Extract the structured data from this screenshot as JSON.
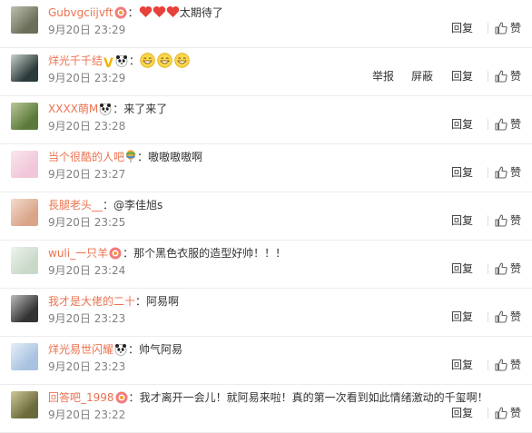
{
  "comments": [
    {
      "user": "Gubvgciijvft",
      "badge": "vip-flower",
      "separator": "：",
      "text_parts": [
        "heart",
        "heart",
        "heart",
        "太期待了"
      ],
      "time": "9月20日 23:29",
      "reply": "回复",
      "like": "赞",
      "avatar_colors": [
        "#6a6f5a",
        "#bfc0b0"
      ],
      "report": "",
      "block": ""
    },
    {
      "user": "烊光千千结",
      "badge": "v-panda",
      "separator": "：",
      "text_parts": [
        "emoji-grin",
        "emoji-grin",
        "emoji-grin"
      ],
      "time": "9月20日 23:29",
      "reply": "回复",
      "like": "赞",
      "report": "举报",
      "block": "屏蔽",
      "avatar_colors": [
        "#2b3a3a",
        "#c7d0c8"
      ]
    },
    {
      "user": "XXXX萌M",
      "badge": "panda",
      "separator": "：",
      "text": "来了来了",
      "time": "9月20日 23:28",
      "reply": "回复",
      "like": "赞",
      "avatar_colors": [
        "#5c7a3a",
        "#b8c89a"
      ],
      "report": "",
      "block": ""
    },
    {
      "user": "当个很酷的人吧",
      "badge": "balloon",
      "separator": "：",
      "text": "嗷嗷嗷嗷啊",
      "time": "9月20日 23:27",
      "reply": "回复",
      "like": "赞",
      "avatar_colors": [
        "#f0c6d8",
        "#fbe6ef"
      ],
      "report": "",
      "block": ""
    },
    {
      "user": "長腿老头__",
      "badge": "",
      "separator": "：",
      "text": "@李佳旭s",
      "time": "9月20日 23:25",
      "reply": "回复",
      "like": "赞",
      "avatar_colors": [
        "#d9a48a",
        "#f3dccd"
      ],
      "report": "",
      "block": ""
    },
    {
      "user": "wuli_一只羊",
      "badge": "vip-flower",
      "separator": "：",
      "text": "那个黑色衣服的造型好帅！！！",
      "time": "9月20日 23:24",
      "reply": "回复",
      "like": "赞",
      "avatar_colors": [
        "#c9d9c9",
        "#eef3ee"
      ],
      "report": "",
      "block": ""
    },
    {
      "user": "我才是大佬的二十",
      "badge": "",
      "separator": "：",
      "text": "阿易啊",
      "time": "9月20日 23:23",
      "reply": "回复",
      "like": "赞",
      "avatar_colors": [
        "#333333",
        "#bbbbbb"
      ],
      "report": "",
      "block": ""
    },
    {
      "user": "烊光易世闪耀",
      "badge": "panda",
      "separator": "：",
      "text": "帅气阿易",
      "time": "9月20日 23:23",
      "reply": "回复",
      "like": "赞",
      "avatar_colors": [
        "#a8c2e0",
        "#e6eef8"
      ],
      "report": "",
      "block": ""
    },
    {
      "user": "回答吧_1998",
      "badge": "vip-flower",
      "separator": "：",
      "text": "我才离开一会儿！就阿易来啦！真的第一次看到如此情绪激动的千玺啊！",
      "time": "9月20日 23:22",
      "reply": "回复",
      "like": "赞",
      "avatar_colors": [
        "#6b6a3a",
        "#d0c89a"
      ],
      "report": "",
      "block": ""
    }
  ],
  "colors": {
    "username": "#eb7350",
    "time": "#808080",
    "text": "#333333",
    "divider": "#ececec"
  },
  "icons": {
    "like": "thumbs-up-icon",
    "vip": "vip-flower-icon",
    "verified": "verified-v-icon",
    "panda": "panda-icon",
    "balloon": "balloon-icon",
    "heart": "red-heart-emoji",
    "grin": "grin-emoji"
  }
}
